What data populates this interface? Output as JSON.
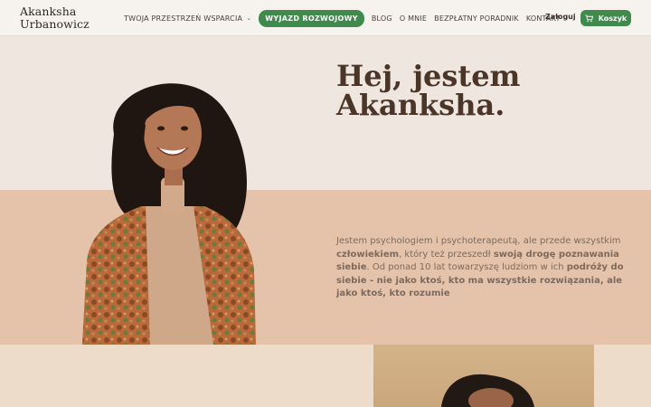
{
  "nav": {
    "logo_line1": "Akanksha",
    "logo_line2": "Urbanowicz",
    "items": [
      {
        "label": "TWOJA PRZESTRZEŃ WSPARCIA",
        "dropdown": true
      },
      {
        "label": "WYJAZD ROZWOJOWY",
        "highlight": true
      },
      {
        "label": "BLOG"
      },
      {
        "label": "O MNIE"
      },
      {
        "label": "BEZPŁATNY PORADNIK"
      },
      {
        "label": "KONTAKT"
      }
    ],
    "login": "Zaloguj",
    "cart": "Koszyk",
    "cart_icon": "cart-icon",
    "accent": "#3f8a4c"
  },
  "hero": {
    "title_line1": "Hej, jestem",
    "title_line2": "Akanksha.",
    "text_part1": "Jestem psychologiem i psychoterapeutą, ale przede wszystkim ",
    "text_bold1": "człowiekiem",
    "text_part2": ", który też przeszedł ",
    "text_bold2": "swoją drogę poznawania siebie",
    "text_part3": ". Od ponad 10 lat towarzyszę ludziom w ich ",
    "text_bold3": "podróży do siebie - nie jako ktoś, kto ma wszystkie rozwiązania, ale jako ktoś, kto rozumie",
    "colors": {
      "top": "#efe6df",
      "mid": "#e5c3ab",
      "title": "#4a3528"
    }
  }
}
